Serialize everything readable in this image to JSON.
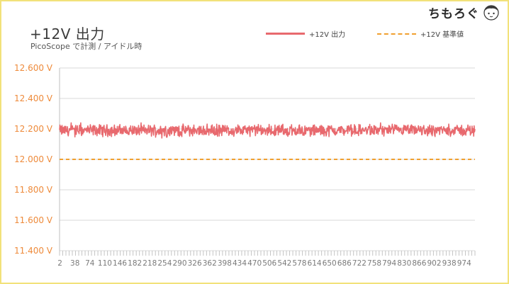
{
  "logo_text": "ちもろぐ",
  "chart_data": {
    "type": "line",
    "title": "+12V 出力",
    "subtitle": "PicoScope で計測 / アイドル時",
    "xlabel": "",
    "ylabel": "",
    "ylim": [
      11.4,
      12.6
    ],
    "yticks": [
      12.6,
      12.4,
      12.2,
      12.0,
      11.8,
      11.6,
      11.4
    ],
    "ytick_labels": [
      "12.600 V",
      "12.400 V",
      "12.200 V",
      "12.000 V",
      "11.800 V",
      "11.600 V",
      "11.400 V"
    ],
    "x_tick_labels": [
      "2",
      "38",
      "74",
      "110",
      "146",
      "182",
      "218",
      "254",
      "290",
      "326",
      "362",
      "398",
      "434",
      "470",
      "506",
      "542",
      "578",
      "614",
      "650",
      "686",
      "722",
      "758",
      "794",
      "830",
      "866",
      "902",
      "938",
      "974"
    ],
    "xlim": [
      1,
      1000
    ],
    "grid": true,
    "legend_position": "top-right",
    "series": [
      {
        "name": "+12V 出力",
        "color": "#e8696e",
        "style": "solid",
        "mean": 12.19,
        "range": [
          12.11,
          12.24
        ],
        "n_points": 1000
      },
      {
        "name": "+12V 基準値",
        "color": "#f0a030",
        "style": "dashed",
        "value": 12.0
      }
    ]
  },
  "colors": {
    "axis_label": "#ee8a3a",
    "x_label": "#7a7a7a",
    "grid": "#d9d9d9",
    "border": "#f2e27a"
  }
}
